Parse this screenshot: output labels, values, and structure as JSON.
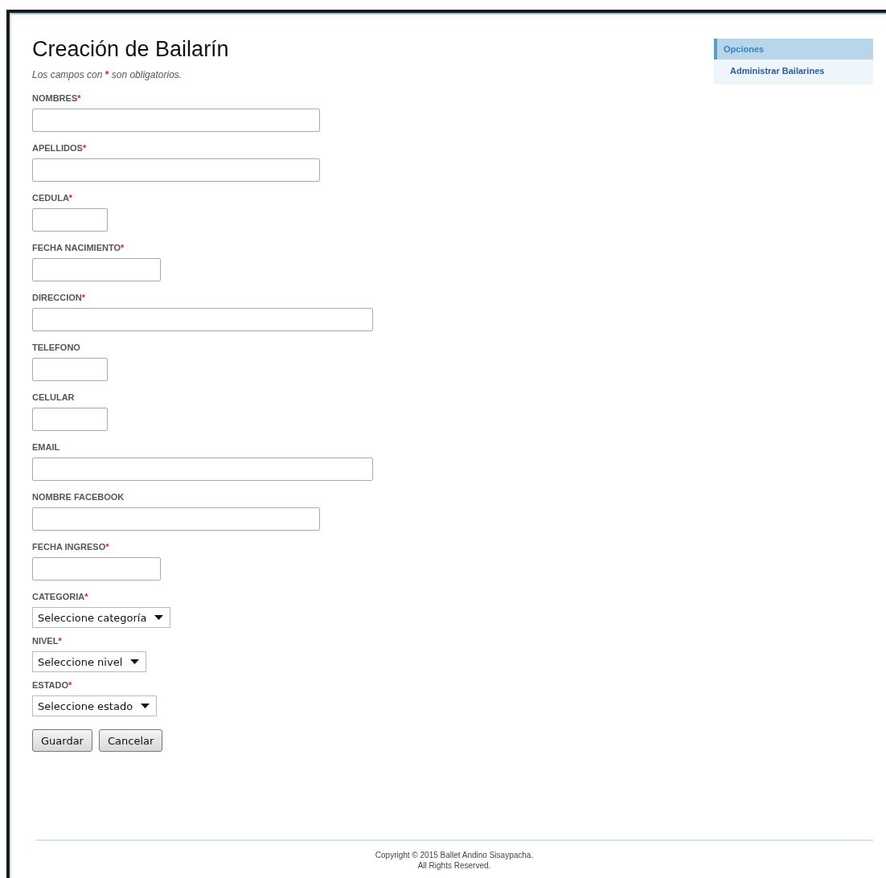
{
  "page": {
    "title": "Creación de Bailarín",
    "note_before": "Los campos con",
    "note_mark": "*",
    "note_after": "son obligatorios."
  },
  "fields": [
    {
      "label": "NOMBRES",
      "required": true,
      "kind": "long"
    },
    {
      "label": "APELLIDOS",
      "required": true,
      "kind": "long"
    },
    {
      "label": "CEDULA",
      "required": true,
      "kind": "short"
    },
    {
      "label": "FECHA NACIMIENTO",
      "required": true,
      "kind": "medium"
    },
    {
      "label": "DIRECCION",
      "required": true,
      "kind": "wide"
    },
    {
      "label": "TELEFONO",
      "required": false,
      "kind": "short"
    },
    {
      "label": "CELULAR",
      "required": false,
      "kind": "short"
    },
    {
      "label": "EMAIL",
      "required": false,
      "kind": "wide"
    },
    {
      "label": "NOMBRE FACEBOOK",
      "required": false,
      "kind": "long"
    },
    {
      "label": "FECHA INGRESO",
      "required": true,
      "kind": "medium"
    },
    {
      "label": "CATEGORIA",
      "required": true,
      "kind": "select",
      "value": "Seleccione categoría"
    },
    {
      "label": "NIVEL",
      "required": true,
      "kind": "select",
      "value": "Seleccione nivel"
    },
    {
      "label": "ESTADO",
      "required": true,
      "kind": "select",
      "value": "Seleccione estado"
    }
  ],
  "buttons": [
    "Guardar",
    "Cancelar"
  ],
  "sidebar": {
    "title": "Opciones",
    "items": [
      "Administrar Bailarines"
    ]
  },
  "footer": [
    "Copyright © 2015 Ballet Andino Sisaypacha.",
    "All Rights Reserved."
  ]
}
